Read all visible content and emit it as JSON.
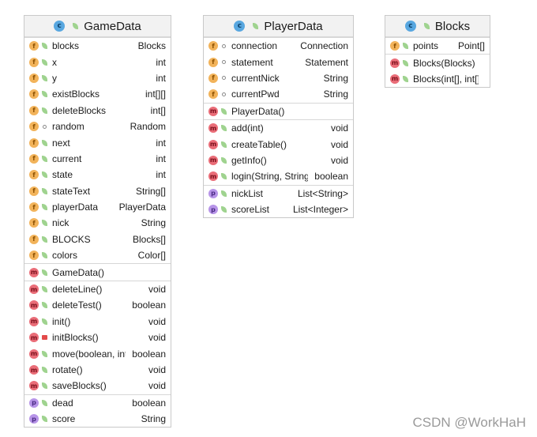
{
  "classes": [
    {
      "name": "GameData",
      "fields": [
        {
          "vis": "pub",
          "name": "blocks",
          "type": "Blocks"
        },
        {
          "vis": "pub",
          "name": "x",
          "type": "int"
        },
        {
          "vis": "pub",
          "name": "y",
          "type": "int"
        },
        {
          "vis": "pub",
          "name": "existBlocks",
          "type": "int[][]"
        },
        {
          "vis": "pub",
          "name": "deleteBlocks",
          "type": "int[]"
        },
        {
          "vis": "pkg",
          "name": "random",
          "type": "Random"
        },
        {
          "vis": "pub",
          "name": "next",
          "type": "int"
        },
        {
          "vis": "pub",
          "name": "current",
          "type": "int"
        },
        {
          "vis": "pub",
          "name": "state",
          "type": "int"
        },
        {
          "vis": "pub",
          "name": "stateText",
          "type": "String[]"
        },
        {
          "vis": "pub",
          "name": "playerData",
          "type": "PlayerData"
        },
        {
          "vis": "pub",
          "name": "nick",
          "type": "String"
        },
        {
          "vis": "pub",
          "name": "BLOCKS",
          "type": "Blocks[]"
        },
        {
          "vis": "pub",
          "name": "colors",
          "type": "Color[]"
        }
      ],
      "constructors": [
        {
          "vis": "pub",
          "name": "GameData()",
          "type": ""
        }
      ],
      "methods": [
        {
          "vis": "pub",
          "name": "deleteLine()",
          "type": "void"
        },
        {
          "vis": "pub",
          "name": "deleteTest()",
          "type": "boolean"
        },
        {
          "vis": "pub",
          "name": "init()",
          "type": "void"
        },
        {
          "vis": "pri",
          "name": "initBlocks()",
          "type": "void"
        },
        {
          "vis": "pub",
          "name": "move(boolean, int)",
          "type": "boolean"
        },
        {
          "vis": "pub",
          "name": "rotate()",
          "type": "void"
        },
        {
          "vis": "pub",
          "name": "saveBlocks()",
          "type": "void"
        }
      ],
      "properties": [
        {
          "vis": "pub",
          "name": "dead",
          "type": "boolean"
        },
        {
          "vis": "pub",
          "name": "score",
          "type": "String"
        }
      ]
    },
    {
      "name": "PlayerData",
      "fields": [
        {
          "vis": "pkg",
          "name": "connection",
          "type": "Connection"
        },
        {
          "vis": "pkg",
          "name": "statement",
          "type": "Statement"
        },
        {
          "vis": "pkg",
          "name": "currentNick",
          "type": "String"
        },
        {
          "vis": "pkg",
          "name": "currentPwd",
          "type": "String"
        }
      ],
      "constructors": [
        {
          "vis": "pub",
          "name": "PlayerData()",
          "type": ""
        }
      ],
      "methods": [
        {
          "vis": "pub",
          "name": "add(int)",
          "type": "void"
        },
        {
          "vis": "pub",
          "name": "createTable()",
          "type": "void"
        },
        {
          "vis": "pub",
          "name": "getInfo()",
          "type": "void"
        },
        {
          "vis": "pub",
          "name": "login(String, String)",
          "type": "boolean"
        }
      ],
      "properties": [
        {
          "vis": "pub",
          "name": "nickList",
          "type": "List<String>"
        },
        {
          "vis": "pub",
          "name": "scoreList",
          "type": "List<Integer>"
        }
      ]
    },
    {
      "name": "Blocks",
      "fields": [
        {
          "vis": "pub",
          "name": "points",
          "type": "Point[]"
        }
      ],
      "constructors": [
        {
          "vis": "pub",
          "name": "Blocks(Blocks)",
          "type": ""
        },
        {
          "vis": "pub",
          "name": "Blocks(int[], int[])",
          "type": ""
        }
      ],
      "methods": [],
      "properties": []
    }
  ],
  "icons": {
    "class": "c",
    "field": "f",
    "method": "m",
    "property": "p"
  },
  "colors": {
    "field": "#f2b35a",
    "method": "#ea6d78",
    "property": "#b794e8",
    "class": "#58a7e0"
  },
  "watermark": "CSDN @WorkHaH"
}
